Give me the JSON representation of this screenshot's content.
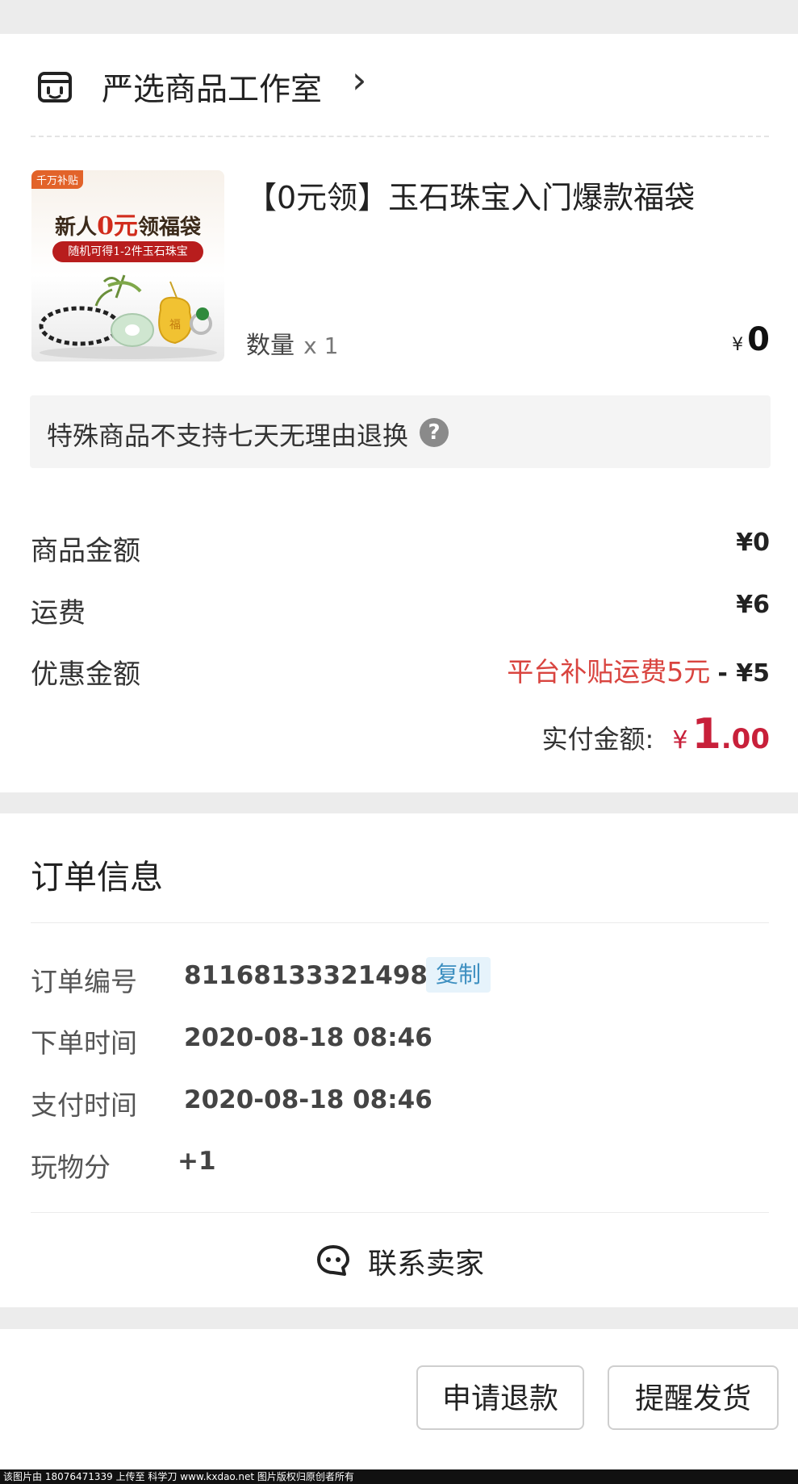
{
  "shop": {
    "name": "严选商品工作室",
    "chevron": "›"
  },
  "product": {
    "title": "【0元领】玉石珠宝入门爆款福袋",
    "image": {
      "corner_badge": "千万补贴",
      "headline_prefix": "新人",
      "headline_zero": "0元",
      "headline_suffix": "领福袋",
      "sub_banner": "随机可得1-2件玉石珠宝"
    },
    "qty_label": "数量",
    "qty_value": "x 1",
    "price_symbol": "¥",
    "price": "0"
  },
  "notice": {
    "text": "特殊商品不支持七天无理由退换",
    "help_icon": "?"
  },
  "summary": {
    "goods_label": "商品金额",
    "goods_value": "¥0",
    "shipping_label": "运费",
    "shipping_value": "¥6",
    "discount_label": "优惠金额",
    "discount_note": "平台补贴运费5元",
    "discount_value": "- ¥5",
    "paid_label": "实付金额:",
    "paid_symbol": "¥",
    "paid_int": "1",
    "paid_dec": ".00"
  },
  "order_info": {
    "title": "订单信息",
    "order_no_label": "订单编号",
    "order_no_value": "811681333214986",
    "copy_label": "复制",
    "order_time_label": "下单时间",
    "order_time_value": "2020-08-18 08:46",
    "pay_time_label": "支付时间",
    "pay_time_value": "2020-08-18 08:46",
    "points_label": "玩物分",
    "points_value": "+1",
    "contact_label": "联系卖家"
  },
  "actions": {
    "refund_label": "申请退款",
    "remind_label": "提醒发货"
  },
  "watermark": "该图片由 18076471339 上传至 科学刀 www.kxdao.net 图片版权归原创者所有",
  "colors": {
    "accent_red": "#c8203a",
    "copy_bg": "#e6f3fb",
    "copy_text": "#3d8fc0",
    "page_bg": "#ececec"
  },
  "icons": [
    "shop-icon",
    "chevron-right-icon",
    "help-icon",
    "chat-icon"
  ]
}
